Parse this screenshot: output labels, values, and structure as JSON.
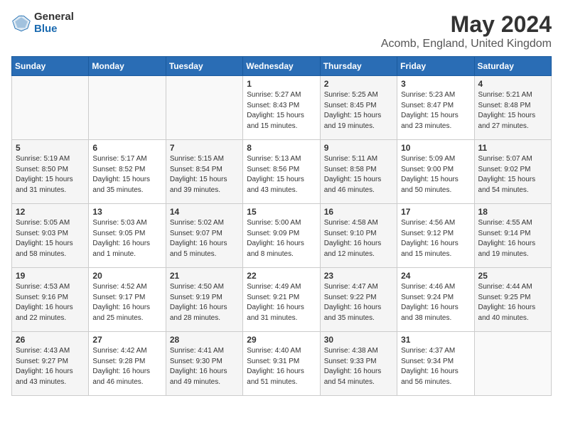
{
  "logo": {
    "general": "General",
    "blue": "Blue"
  },
  "title": "May 2024",
  "subtitle": "Acomb, England, United Kingdom",
  "days_of_week": [
    "Sunday",
    "Monday",
    "Tuesday",
    "Wednesday",
    "Thursday",
    "Friday",
    "Saturday"
  ],
  "weeks": [
    [
      {
        "day": "",
        "info": ""
      },
      {
        "day": "",
        "info": ""
      },
      {
        "day": "",
        "info": ""
      },
      {
        "day": "1",
        "info": "Sunrise: 5:27 AM\nSunset: 8:43 PM\nDaylight: 15 hours\nand 15 minutes."
      },
      {
        "day": "2",
        "info": "Sunrise: 5:25 AM\nSunset: 8:45 PM\nDaylight: 15 hours\nand 19 minutes."
      },
      {
        "day": "3",
        "info": "Sunrise: 5:23 AM\nSunset: 8:47 PM\nDaylight: 15 hours\nand 23 minutes."
      },
      {
        "day": "4",
        "info": "Sunrise: 5:21 AM\nSunset: 8:48 PM\nDaylight: 15 hours\nand 27 minutes."
      }
    ],
    [
      {
        "day": "5",
        "info": "Sunrise: 5:19 AM\nSunset: 8:50 PM\nDaylight: 15 hours\nand 31 minutes."
      },
      {
        "day": "6",
        "info": "Sunrise: 5:17 AM\nSunset: 8:52 PM\nDaylight: 15 hours\nand 35 minutes."
      },
      {
        "day": "7",
        "info": "Sunrise: 5:15 AM\nSunset: 8:54 PM\nDaylight: 15 hours\nand 39 minutes."
      },
      {
        "day": "8",
        "info": "Sunrise: 5:13 AM\nSunset: 8:56 PM\nDaylight: 15 hours\nand 43 minutes."
      },
      {
        "day": "9",
        "info": "Sunrise: 5:11 AM\nSunset: 8:58 PM\nDaylight: 15 hours\nand 46 minutes."
      },
      {
        "day": "10",
        "info": "Sunrise: 5:09 AM\nSunset: 9:00 PM\nDaylight: 15 hours\nand 50 minutes."
      },
      {
        "day": "11",
        "info": "Sunrise: 5:07 AM\nSunset: 9:02 PM\nDaylight: 15 hours\nand 54 minutes."
      }
    ],
    [
      {
        "day": "12",
        "info": "Sunrise: 5:05 AM\nSunset: 9:03 PM\nDaylight: 15 hours\nand 58 minutes."
      },
      {
        "day": "13",
        "info": "Sunrise: 5:03 AM\nSunset: 9:05 PM\nDaylight: 16 hours\nand 1 minute."
      },
      {
        "day": "14",
        "info": "Sunrise: 5:02 AM\nSunset: 9:07 PM\nDaylight: 16 hours\nand 5 minutes."
      },
      {
        "day": "15",
        "info": "Sunrise: 5:00 AM\nSunset: 9:09 PM\nDaylight: 16 hours\nand 8 minutes."
      },
      {
        "day": "16",
        "info": "Sunrise: 4:58 AM\nSunset: 9:10 PM\nDaylight: 16 hours\nand 12 minutes."
      },
      {
        "day": "17",
        "info": "Sunrise: 4:56 AM\nSunset: 9:12 PM\nDaylight: 16 hours\nand 15 minutes."
      },
      {
        "day": "18",
        "info": "Sunrise: 4:55 AM\nSunset: 9:14 PM\nDaylight: 16 hours\nand 19 minutes."
      }
    ],
    [
      {
        "day": "19",
        "info": "Sunrise: 4:53 AM\nSunset: 9:16 PM\nDaylight: 16 hours\nand 22 minutes."
      },
      {
        "day": "20",
        "info": "Sunrise: 4:52 AM\nSunset: 9:17 PM\nDaylight: 16 hours\nand 25 minutes."
      },
      {
        "day": "21",
        "info": "Sunrise: 4:50 AM\nSunset: 9:19 PM\nDaylight: 16 hours\nand 28 minutes."
      },
      {
        "day": "22",
        "info": "Sunrise: 4:49 AM\nSunset: 9:21 PM\nDaylight: 16 hours\nand 31 minutes."
      },
      {
        "day": "23",
        "info": "Sunrise: 4:47 AM\nSunset: 9:22 PM\nDaylight: 16 hours\nand 35 minutes."
      },
      {
        "day": "24",
        "info": "Sunrise: 4:46 AM\nSunset: 9:24 PM\nDaylight: 16 hours\nand 38 minutes."
      },
      {
        "day": "25",
        "info": "Sunrise: 4:44 AM\nSunset: 9:25 PM\nDaylight: 16 hours\nand 40 minutes."
      }
    ],
    [
      {
        "day": "26",
        "info": "Sunrise: 4:43 AM\nSunset: 9:27 PM\nDaylight: 16 hours\nand 43 minutes."
      },
      {
        "day": "27",
        "info": "Sunrise: 4:42 AM\nSunset: 9:28 PM\nDaylight: 16 hours\nand 46 minutes."
      },
      {
        "day": "28",
        "info": "Sunrise: 4:41 AM\nSunset: 9:30 PM\nDaylight: 16 hours\nand 49 minutes."
      },
      {
        "day": "29",
        "info": "Sunrise: 4:40 AM\nSunset: 9:31 PM\nDaylight: 16 hours\nand 51 minutes."
      },
      {
        "day": "30",
        "info": "Sunrise: 4:38 AM\nSunset: 9:33 PM\nDaylight: 16 hours\nand 54 minutes."
      },
      {
        "day": "31",
        "info": "Sunrise: 4:37 AM\nSunset: 9:34 PM\nDaylight: 16 hours\nand 56 minutes."
      },
      {
        "day": "",
        "info": ""
      }
    ]
  ]
}
